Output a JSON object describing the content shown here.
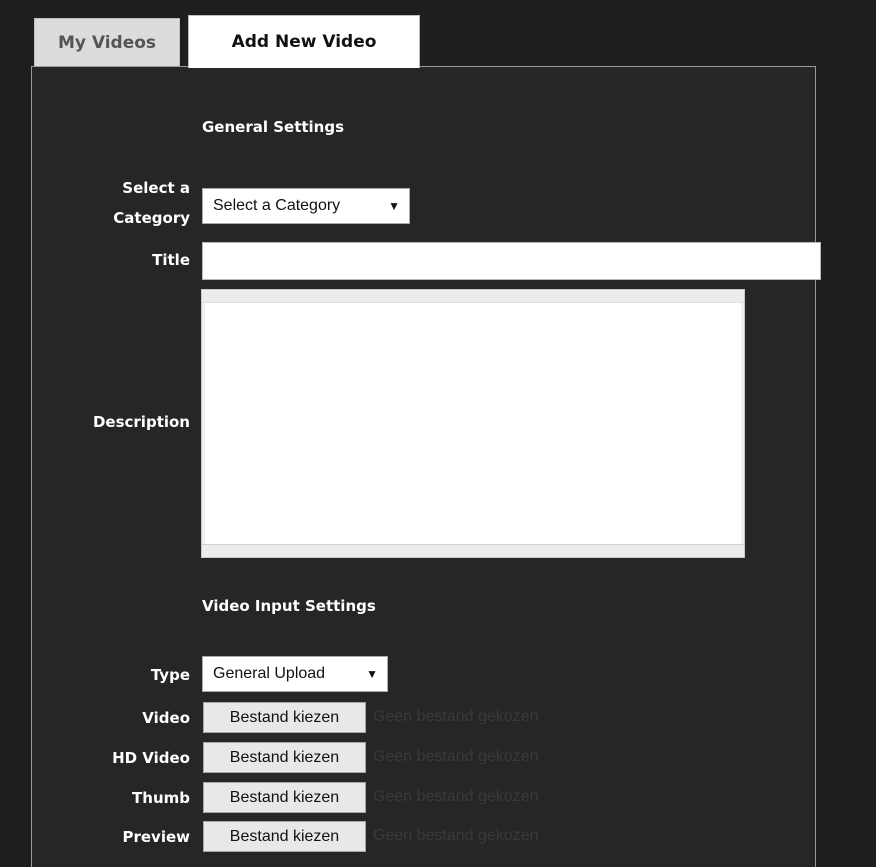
{
  "tabs": [
    {
      "label": "My Videos"
    },
    {
      "label": "Add New Video"
    }
  ],
  "form": {
    "general_settings_heading": "General Settings",
    "category_label_line1": "Select a",
    "category_label_line2": "Category",
    "category_select_value": "Select a Category",
    "title_label": "Title",
    "title_value": "",
    "description_label": "Description",
    "video_input_heading": "Video Input Settings",
    "type_label": "Type",
    "type_select_value": "General Upload",
    "file_rows": [
      {
        "label": "Video",
        "button": "Bestand kiezen",
        "status": "Geen bestand gekozen"
      },
      {
        "label": "HD Video",
        "button": "Bestand kiezen",
        "status": "Geen bestand gekozen"
      },
      {
        "label": "Thumb",
        "button": "Bestand kiezen",
        "status": "Geen bestand gekozen"
      },
      {
        "label": "Preview",
        "button": "Bestand kiezen",
        "status": "Geen bestand gekozen"
      }
    ]
  },
  "icons": {
    "dropdown": "triangle-down-icon"
  }
}
